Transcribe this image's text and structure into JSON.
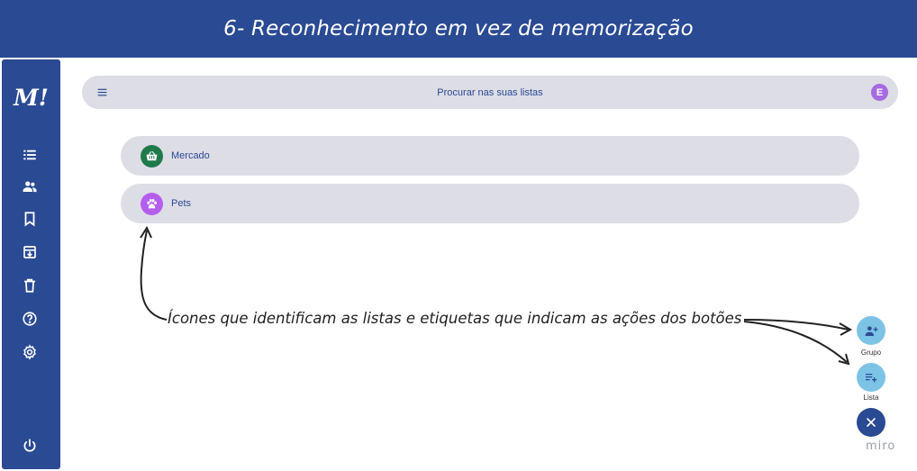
{
  "header": {
    "title": "6- Reconhecimento em vez de memorização"
  },
  "sidebar": {
    "logo": "M!",
    "items": [
      {
        "name": "lists",
        "icon": "list-icon"
      },
      {
        "name": "groups",
        "icon": "group-icon"
      },
      {
        "name": "bookmarks",
        "icon": "bookmark-icon"
      },
      {
        "name": "archive",
        "icon": "archive-icon"
      },
      {
        "name": "trash",
        "icon": "trash-icon"
      },
      {
        "name": "help",
        "icon": "help-icon"
      },
      {
        "name": "settings",
        "icon": "gear-icon"
      }
    ],
    "logout_icon": "power-icon"
  },
  "search": {
    "placeholder": "Procurar nas suas listas",
    "avatar_letter": "E",
    "avatar_color": "#a56be0"
  },
  "lists": [
    {
      "label": "Mercado",
      "icon": "basket-icon",
      "color": "#1f7a4c"
    },
    {
      "label": "Pets",
      "icon": "paw-icon",
      "color": "#b45ef0"
    }
  ],
  "annotation": {
    "text": "Ícones que identificam as listas e etiquetas que indicam as ações dos botões"
  },
  "fabs": {
    "group_label": "Grupo",
    "list_label": "Lista",
    "action_color": "#7cc3e6",
    "close_color": "#2a4a93"
  },
  "watermark": "miro",
  "colors": {
    "primary": "#2a4a93",
    "surface": "#dddde6"
  }
}
